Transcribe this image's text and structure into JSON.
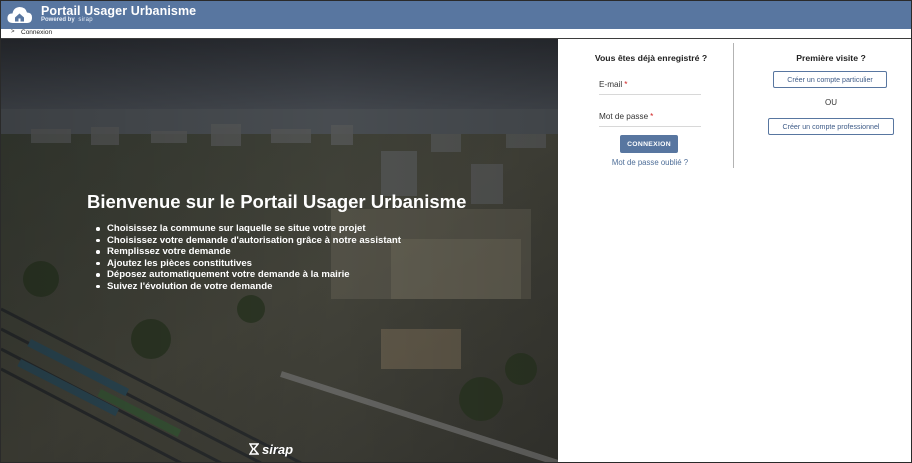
{
  "header": {
    "title": "Portail Usager Urbanisme",
    "powered_by": "Powered by",
    "powered_brand": "sirap"
  },
  "breadcrumb": {
    "chevron": ">",
    "label": "Connexion"
  },
  "hero": {
    "title": "Bienvenue sur le Portail Usager Urbanisme",
    "bullets": [
      "Choisissez la commune sur laquelle se situe votre projet",
      "Choisissez votre demande d'autorisation grâce à notre assistant",
      "Remplissez votre demande",
      "Ajoutez les pièces constitutives",
      "Déposez automatiquement votre demande à la mairie",
      "Suivez l'évolution de votre demande"
    ],
    "footer_brand": "sirap"
  },
  "login": {
    "title": "Vous êtes déjà enregistré ?",
    "email_label": "E-mail",
    "password_label": "Mot de passe",
    "required_mark": "*",
    "submit_label": "CONNEXION",
    "forgot_label": "Mot de passe oublié ?"
  },
  "signup": {
    "title": "Première visite ?",
    "individual_label": "Créer un compte particulier",
    "or_label": "OU",
    "professional_label": "Créer un compte professionnel"
  },
  "colors": {
    "header_bg": "#5876a0",
    "button_bg": "#5876a0",
    "link": "#4e6e98",
    "required": "#d12424"
  }
}
